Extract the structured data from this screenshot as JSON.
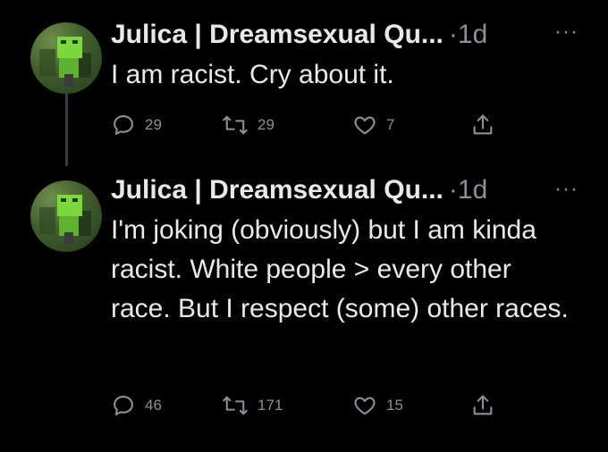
{
  "tweets": [
    {
      "name": "Julica | Dreamsexual Qu...",
      "separator": "·",
      "time": "1d",
      "text": "I am racist. Cry about it.",
      "replies": "29",
      "retweets": "29",
      "likes": "7"
    },
    {
      "name": "Julica | Dreamsexual Qu...",
      "separator": "·",
      "time": "1d",
      "text": "I'm joking (obviously) but I am kinda racist. White people > every other race. But I respect (some) other races.",
      "replies": "46",
      "retweets": "171",
      "likes": "15"
    }
  ],
  "more_label": "···",
  "icons": {
    "reply": "speech-bubble-icon",
    "retweet": "retweet-arrows-icon",
    "like": "heart-icon",
    "share": "share-upload-icon"
  },
  "colors": {
    "background": "#000000",
    "text": "#e7e9ea",
    "muted": "#8b9095"
  }
}
